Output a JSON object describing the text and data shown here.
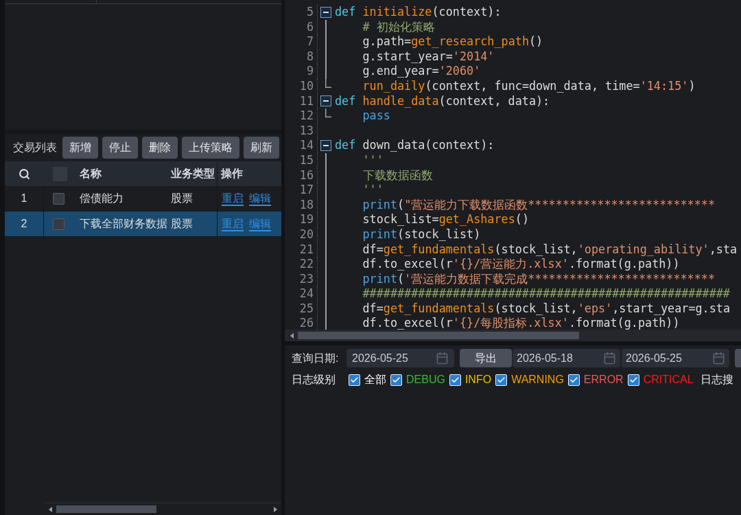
{
  "strategy_panel": {
    "toolbar": {
      "title": "交易列表",
      "buttons": [
        "新增",
        "停止",
        "删除",
        "上传策略",
        "刷新"
      ]
    },
    "table": {
      "select_all_checked": false,
      "columns": [
        "名称",
        "业务类型",
        "操作"
      ],
      "rows": [
        {
          "index": "1",
          "checked": false,
          "name": "偿债能力",
          "type": "股票",
          "actions": [
            "重启",
            "编辑"
          ],
          "selected": false
        },
        {
          "index": "2",
          "checked": false,
          "name": "下载全部财务数据",
          "type": "股票",
          "actions": [
            "重启",
            "编辑"
          ],
          "selected": true
        }
      ]
    }
  },
  "editor": {
    "lines": [
      {
        "number": "5",
        "kind": "fold_start",
        "indented": false,
        "tokens": [
          {
            "kind": "keyword",
            "text": "def "
          },
          {
            "kind": "func",
            "text": "initialize"
          },
          {
            "kind": "plain",
            "text": "(context):"
          }
        ]
      },
      {
        "number": "6",
        "kind": "fold_body",
        "indented": true,
        "tokens": [
          {
            "kind": "comment",
            "text": "# 初始化策略"
          }
        ]
      },
      {
        "number": "7",
        "kind": "fold_body",
        "indented": true,
        "tokens": [
          {
            "kind": "plain",
            "text": "g.path="
          },
          {
            "kind": "func",
            "text": "get_research_path"
          },
          {
            "kind": "plain",
            "text": "()"
          }
        ]
      },
      {
        "number": "8",
        "kind": "fold_body",
        "indented": true,
        "tokens": [
          {
            "kind": "plain",
            "text": "g.start_year="
          },
          {
            "kind": "string",
            "text": "'2014'"
          }
        ]
      },
      {
        "number": "9",
        "kind": "fold_body",
        "indented": true,
        "tokens": [
          {
            "kind": "plain",
            "text": "g.end_year="
          },
          {
            "kind": "string",
            "text": "'2060'"
          }
        ]
      },
      {
        "number": "10",
        "kind": "fold_end",
        "indented": true,
        "tokens": [
          {
            "kind": "func",
            "text": "run_daily"
          },
          {
            "kind": "plain",
            "text": "(context, func=down_data, time="
          },
          {
            "kind": "string",
            "text": "'14:15'"
          },
          {
            "kind": "plain",
            "text": ")"
          }
        ]
      },
      {
        "number": "11",
        "kind": "fold_start",
        "indented": false,
        "tokens": [
          {
            "kind": "keyword",
            "text": "def "
          },
          {
            "kind": "func",
            "text": "handle_data"
          },
          {
            "kind": "plain",
            "text": "(context, data):"
          }
        ]
      },
      {
        "number": "12",
        "kind": "fold_end",
        "indented": true,
        "tokens": [
          {
            "kind": "builtin",
            "text": "pass"
          }
        ]
      },
      {
        "number": "13"
      },
      {
        "number": "14",
        "kind": "fold_start",
        "indented": false,
        "tokens": [
          {
            "kind": "keyword",
            "text": "def "
          },
          {
            "kind": "plain",
            "text": "down_data(context):"
          }
        ]
      },
      {
        "number": "15",
        "kind": "fold_body",
        "indented": true,
        "tokens": [
          {
            "kind": "comment",
            "text": "'''"
          }
        ]
      },
      {
        "number": "16",
        "kind": "fold_body",
        "indented": true,
        "tokens": [
          {
            "kind": "comment",
            "text": "下载数据函数"
          }
        ]
      },
      {
        "number": "17",
        "kind": "fold_body",
        "indented": true,
        "tokens": [
          {
            "kind": "comment",
            "text": "'''"
          }
        ]
      },
      {
        "number": "18",
        "kind": "fold_body",
        "indented": true,
        "tokens": [
          {
            "kind": "builtin",
            "text": "print"
          },
          {
            "kind": "plain",
            "text": "("
          },
          {
            "kind": "string",
            "text": "\"营运能力下载数据函数***************************"
          }
        ]
      },
      {
        "number": "19",
        "kind": "fold_body",
        "indented": true,
        "tokens": [
          {
            "kind": "plain",
            "text": "stock_list="
          },
          {
            "kind": "func",
            "text": "get_Ashares"
          },
          {
            "kind": "plain",
            "text": "()"
          }
        ]
      },
      {
        "number": "20",
        "kind": "fold_body",
        "indented": true,
        "tokens": [
          {
            "kind": "builtin",
            "text": "print"
          },
          {
            "kind": "plain",
            "text": "(stock_list)"
          }
        ]
      },
      {
        "number": "21",
        "kind": "fold_body",
        "indented": true,
        "tokens": [
          {
            "kind": "plain",
            "text": "df="
          },
          {
            "kind": "func",
            "text": "get_fundamentals"
          },
          {
            "kind": "plain",
            "text": "(stock_list,"
          },
          {
            "kind": "string",
            "text": "'operating_ability'"
          },
          {
            "kind": "plain",
            "text": ",sta"
          }
        ]
      },
      {
        "number": "22",
        "kind": "fold_body",
        "indented": true,
        "tokens": [
          {
            "kind": "plain",
            "text": "df.to_excel(r"
          },
          {
            "kind": "string",
            "text": "'{}/营运能力.xlsx'"
          },
          {
            "kind": "plain",
            "text": ".format(g.path))"
          }
        ]
      },
      {
        "number": "23",
        "kind": "fold_body",
        "indented": true,
        "tokens": [
          {
            "kind": "builtin",
            "text": "print"
          },
          {
            "kind": "plain",
            "text": "("
          },
          {
            "kind": "string",
            "text": "'营运能力数据下载完成***************************"
          }
        ]
      },
      {
        "number": "24",
        "kind": "fold_body",
        "indented": true,
        "tokens": [
          {
            "kind": "comment",
            "text": "#####################################################"
          }
        ]
      },
      {
        "number": "25",
        "kind": "fold_body",
        "indented": true,
        "tokens": [
          {
            "kind": "plain",
            "text": "df="
          },
          {
            "kind": "func",
            "text": "get_fundamentals"
          },
          {
            "kind": "plain",
            "text": "(stock_list,"
          },
          {
            "kind": "string",
            "text": "'eps'"
          },
          {
            "kind": "plain",
            "text": ",start_year=g.sta"
          }
        ]
      },
      {
        "number": "26",
        "kind": "fold_body",
        "indented": true,
        "tokens": [
          {
            "kind": "plain",
            "text": "df.to_excel(r"
          },
          {
            "kind": "string",
            "text": "'{}/每股指标.xlsx'"
          },
          {
            "kind": "plain",
            "text": ".format(g.path))"
          }
        ]
      }
    ]
  },
  "log_panel": {
    "query_label": "查询日期:",
    "query_date": "2026-05-25",
    "export_button": "导出",
    "start_date": "2026-05-18",
    "end_date": "2026-05-25",
    "level_label": "日志级别",
    "levels": [
      {
        "label": "全部",
        "checked": true,
        "color": "#ffffff"
      },
      {
        "label": "DEBUG",
        "checked": true,
        "color": "#2ec02e"
      },
      {
        "label": "INFO",
        "checked": true,
        "color": "#e8c000"
      },
      {
        "label": "WARNING",
        "checked": true,
        "color": "#f0a000"
      },
      {
        "label": "ERROR",
        "checked": true,
        "color": "#e85a5a"
      },
      {
        "label": "CRITICAL",
        "checked": true,
        "color": "#ff1a1a"
      }
    ],
    "search_label": "日志搜"
  }
}
